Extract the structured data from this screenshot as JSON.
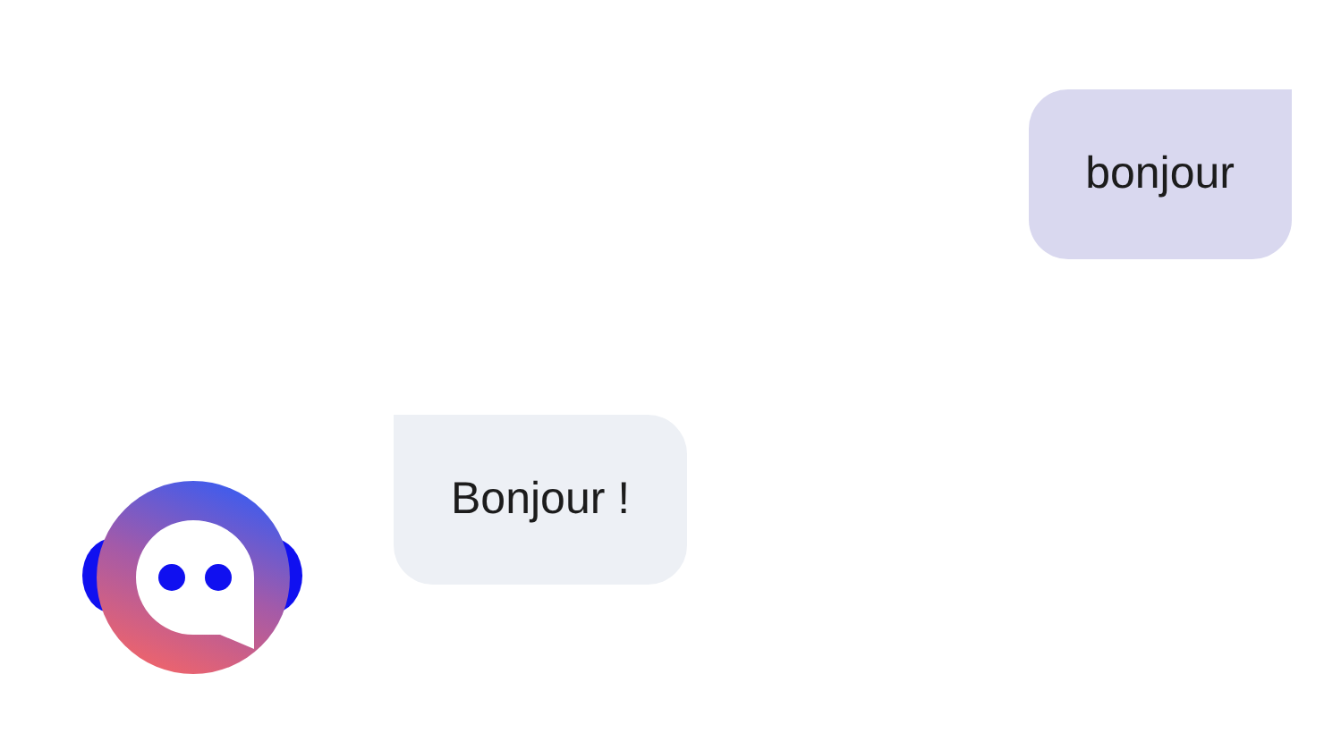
{
  "messages": [
    {
      "kind": "user",
      "text": "bonjour"
    },
    {
      "kind": "bot",
      "text": "Bonjour !"
    }
  ]
}
